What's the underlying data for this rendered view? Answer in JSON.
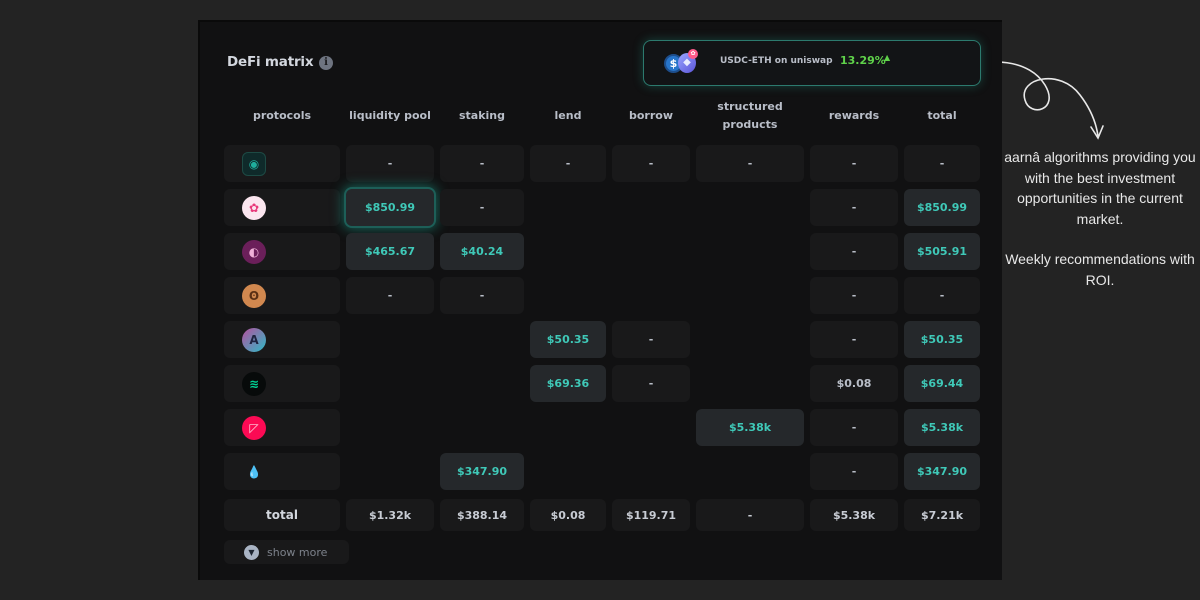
{
  "panel": {
    "title": "DeFi matrix",
    "info_icon": "info-icon"
  },
  "recommendation": {
    "icons": [
      "usdc-icon",
      "eth-icon",
      "uniswap-icon"
    ],
    "pair_label": "USDC-ETH on uniswap",
    "roi": "13.29%",
    "trend_icon": "caret-up-icon",
    "accent_color": "#5fd24a",
    "border_color": "#2c7a6e"
  },
  "columns": [
    "protocols",
    "liquidity pool",
    "staking",
    "lend",
    "borrow",
    "structured products",
    "rewards",
    "total"
  ],
  "columns_display": {
    "structured_line1": "structured",
    "structured_line2": "products"
  },
  "rows": [
    {
      "protocol": "bancor",
      "icon": "bancor-icon",
      "cells": [
        "-",
        "-",
        "-",
        "-",
        "-",
        "-",
        "-"
      ]
    },
    {
      "protocol": "uniswap",
      "icon": "uniswap-icon",
      "cells": [
        "$850.99",
        "-",
        null,
        null,
        null,
        "-",
        "$850.99"
      ]
    },
    {
      "protocol": "sushiswap",
      "icon": "sushiswap-icon",
      "cells": [
        "$465.67",
        "$40.24",
        null,
        null,
        null,
        "-",
        "$505.91"
      ]
    },
    {
      "protocol": "pancakeswap",
      "icon": "pancakeswap-icon",
      "cells": [
        "-",
        "-",
        null,
        null,
        null,
        "-",
        "-"
      ]
    },
    {
      "protocol": "aave",
      "icon": "aave-icon",
      "cells": [
        null,
        null,
        "$50.35",
        "-",
        null,
        "-",
        "$50.35"
      ]
    },
    {
      "protocol": "compound",
      "icon": "compound-icon",
      "cells": [
        null,
        null,
        "$69.36",
        "-",
        null,
        "$0.08",
        "$69.44"
      ]
    },
    {
      "protocol": "ribbon",
      "icon": "ribbon-icon",
      "cells": [
        null,
        null,
        null,
        null,
        "$5.38k",
        "-",
        "$5.38k"
      ]
    },
    {
      "protocol": "lido",
      "icon": "lido-icon",
      "cells": [
        null,
        "$347.90",
        null,
        null,
        null,
        "-",
        "$347.90"
      ]
    }
  ],
  "totals": {
    "label": "total",
    "values": [
      "$1.32k",
      "$388.14",
      "$0.08",
      "$119.71",
      "-",
      "$5.38k",
      "$7.21k"
    ]
  },
  "show_more": {
    "label": "show more",
    "icon": "chevron-down-icon"
  },
  "annotation": {
    "line1": "aarnâ algorithms providing you with the best investment opportunities in the current market.",
    "line2": "Weekly recommendations with ROI."
  },
  "colors": {
    "value_text": "#3fc9b8",
    "highlight_glow": "#1eaa96"
  }
}
